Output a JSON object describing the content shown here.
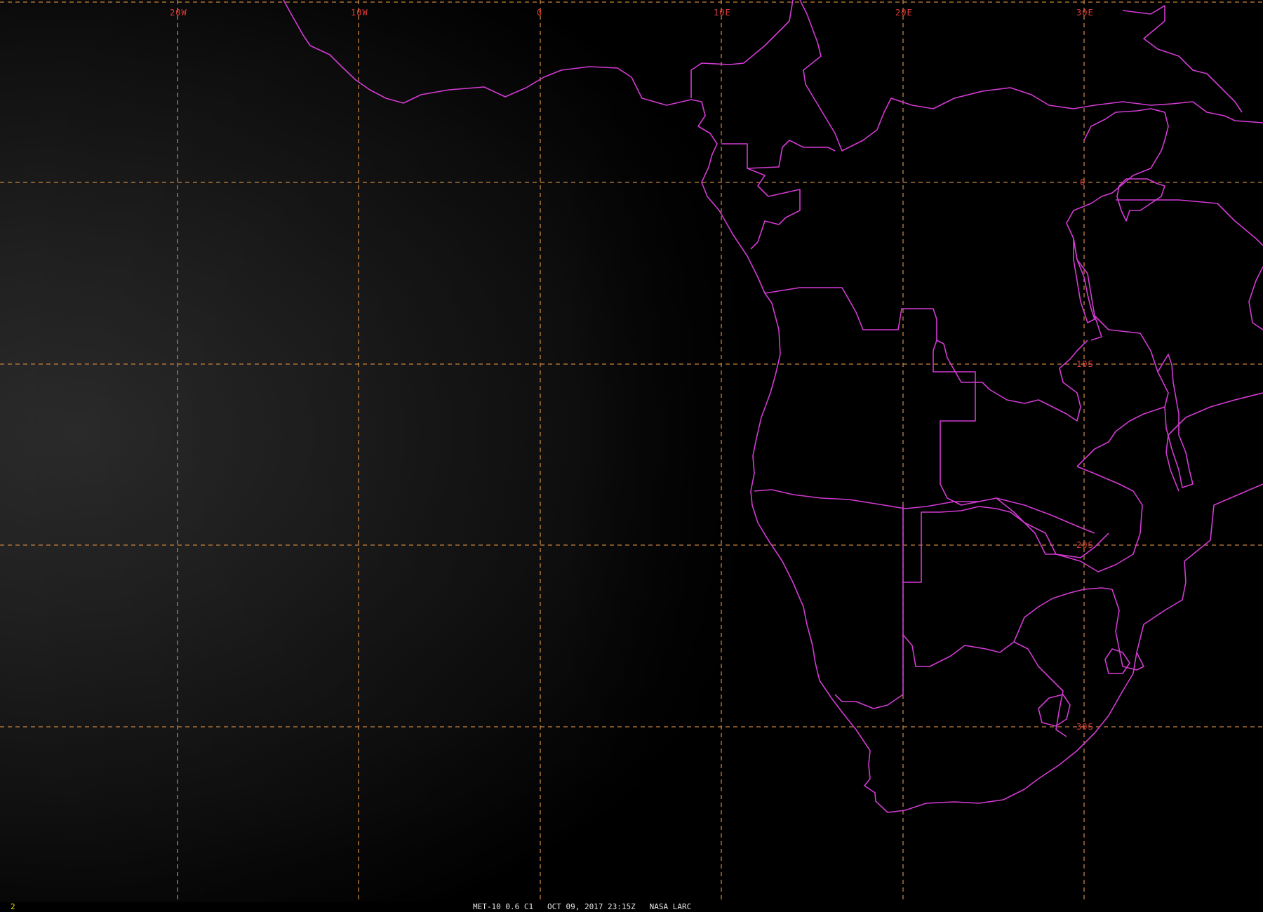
{
  "map": {
    "lon_labels": [
      "20W",
      "10W",
      "0",
      "10E",
      "20E",
      "30E"
    ],
    "lat_labels": [
      "0",
      "10S",
      "20S",
      "30S"
    ],
    "colors": {
      "grid": "#c8823f",
      "grid_label": "#e23a3a",
      "boundaries": "#d23bd2",
      "frame_number": "#f0e000"
    }
  },
  "status_bar": {
    "frame_number": "2",
    "caption": "MET-10 0.6 C1   OCT 09, 2017 23:15Z   NASA LARC"
  }
}
